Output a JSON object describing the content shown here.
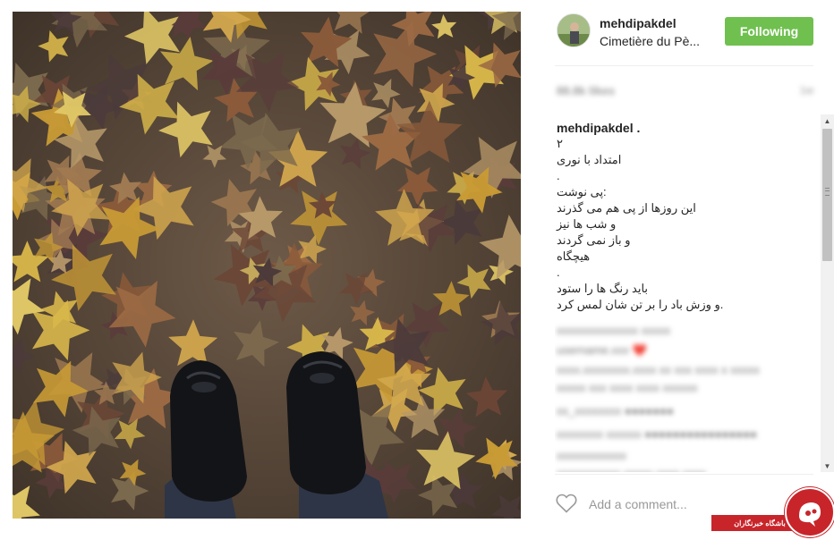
{
  "post": {
    "username": "mehdipakdel",
    "location": "Cimetière du Pè...",
    "follow_label": "Following",
    "likes_blurred": "88.8k likes",
    "age_blurred": "1w",
    "caption_user": "mehdipakdel .",
    "caption_lines": [
      "۲",
      "امتداد با نوری",
      ".",
      ":پی نوشت",
      "این روزها از پی هم می گذرند",
      "و شب ها نیز",
      "و باز نمی گردند",
      "هیچگاه",
      ".",
      "باید رنگ ها را ستود",
      ".و وزش باد را بر تن شان لمس کرد"
    ],
    "blurred_comments": [
      "xxxxxxxxxxxxxx xxxxx",
      "username.xxx ❤️",
      "xxxx.xxxxxxxx.xxxx xx xxx xxxx x xxxxx",
      "xxxxx xxx xxxx xxxx xxxxxx",
      "xx_xxxxxxxx ●●●●●●●",
      "xxxxxxxx xxxxxx ●●●●●●●●●●●●●●●●",
      "xxxxxxxxxxxx",
      "xxxxxxxxxxx xxxxx xxxx xxxx"
    ],
    "comment_placeholder": "Add a comment...",
    "watermark_text": "باشگاه خبرنگاران"
  },
  "colors": {
    "follow": "#70c050",
    "watermark": "#c8252b"
  },
  "icons": {
    "heart": "heart-outline-icon",
    "scroll_up": "scroll-up-arrow-icon",
    "scroll_down": "scroll-down-arrow-icon"
  }
}
